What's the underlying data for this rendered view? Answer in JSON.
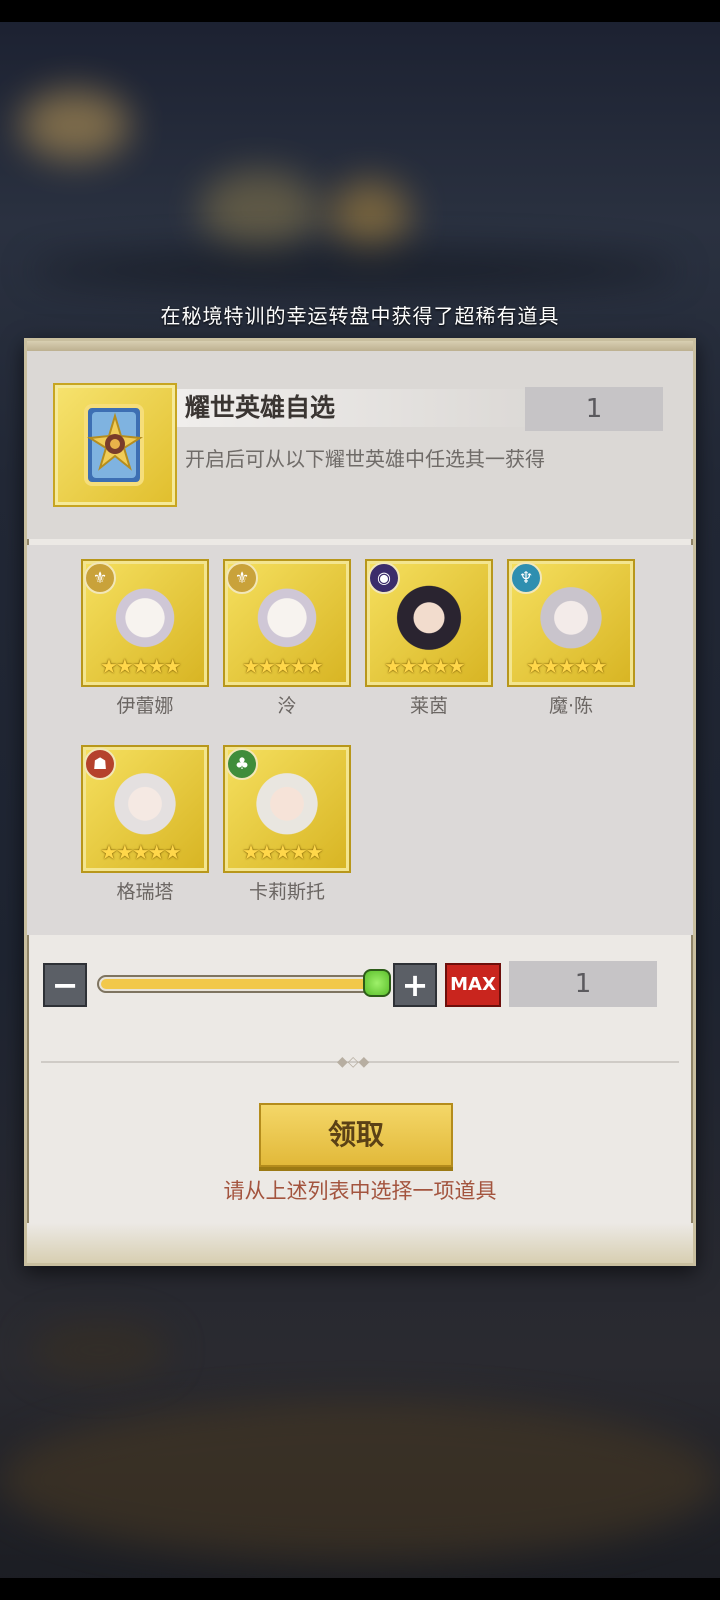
{
  "notice": "在秘境特训的幸运转盘中获得了超稀有道具",
  "item": {
    "icon": "hero-card-icon",
    "title": "耀世英雄自选",
    "owned_count": "1",
    "description": "开启后可从以下耀世英雄中任选其一获得"
  },
  "heroes": [
    {
      "name": "伊蕾娜",
      "stars": "★★★★★",
      "badge": "⚜",
      "badge_color": "#c9a23a"
    },
    {
      "name": "泠",
      "stars": "★★★★★",
      "badge": "⚜",
      "badge_color": "#c9a23a"
    },
    {
      "name": "莱茵",
      "stars": "★★★★★",
      "badge": "◉",
      "badge_color": "#3b2c6b"
    },
    {
      "name": "魔·陈",
      "stars": "★★★★★",
      "badge": "♆",
      "badge_color": "#2f8fb0"
    },
    {
      "name": "格瑞塔",
      "stars": "★★★★★",
      "badge": "☗",
      "badge_color": "#b5412c"
    },
    {
      "name": "卡莉斯托",
      "stars": "★★★★★",
      "badge": "♣",
      "badge_color": "#3f8d3b"
    }
  ],
  "quantity": {
    "minus_label": "−",
    "plus_label": "+",
    "max_label": "MAX",
    "value": "1",
    "slider_fraction": 1.0
  },
  "claim_label": "领取",
  "hint": "请从上述列表中选择一项道具"
}
